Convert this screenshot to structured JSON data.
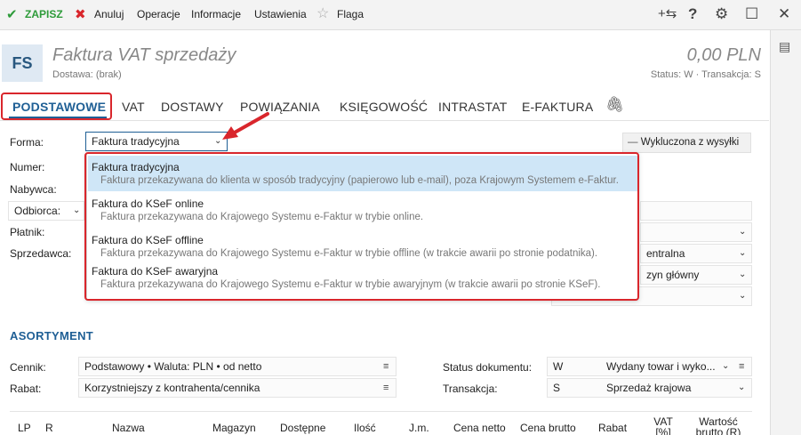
{
  "toolbar": {
    "save": "ZAPISZ",
    "cancel": "Anuluj",
    "operations": "Operacje",
    "information": "Informacje",
    "settings": "Ustawienia",
    "flag": "Flaga"
  },
  "header": {
    "badge": "FS",
    "title": "Faktura VAT sprzedaży",
    "subtitle": "Dostawa: (brak)",
    "amount": "0,00 PLN",
    "status": "Status:  W  ·  Transakcja:  S"
  },
  "tabs": [
    "PODSTAWOWE",
    "VAT",
    "DOSTAWY",
    "POWIĄZANIA",
    "KSIĘGOWOŚĆ",
    "INTRASTAT",
    "E-FAKTURA"
  ],
  "form": {
    "forma_label": "Forma:",
    "forma_value": "Faktura tradycyjna",
    "numer_label": "Numer:",
    "nabywca_label": "Nabywca:",
    "odbiorca_label": "Odbiorca:",
    "platnik_label": "Płatnik:",
    "sprzedawca_label": "Sprzedawca:",
    "excluded": "Wykluczona z wysyłki",
    "centralna": "entralna",
    "glowny": "zyn główny"
  },
  "dropdown": {
    "options": [
      {
        "title": "Faktura tradycyjna",
        "desc": "Faktura przekazywana do klienta w sposób tradycyjny (papierowo lub e-mail), poza Krajowym Systemem e-Faktur."
      },
      {
        "title": "Faktura do KSeF online",
        "desc": "Faktura przekazywana do Krajowego Systemu e-Faktur w trybie online."
      },
      {
        "title": "Faktura do KSeF offline",
        "desc": "Faktura przekazywana do Krajowego Systemu e-Faktur w trybie offline (w trakcie awarii po stronie podatnika)."
      },
      {
        "title": "Faktura do KSeF awaryjna",
        "desc": "Faktura przekazywana do Krajowego Systemu e-Faktur w trybie awaryjnym (w trakcie awarii po stronie KSeF)."
      }
    ]
  },
  "assortment": {
    "title": "ASORTYMENT",
    "cennik_label": "Cennik:",
    "cennik_value": "Podstawowy • Waluta: PLN • od netto",
    "rabat_label": "Rabat:",
    "rabat_value": "Korzystniejszy z kontrahenta/cennika",
    "status_label": "Status dokumentu:",
    "status_code": "W",
    "status_value": "Wydany towar i wyko...",
    "transakcja_label": "Transakcja:",
    "transakcja_code": "S",
    "transakcja_value": "Sprzedaż krajowa"
  },
  "table_headers": [
    "LP",
    "R",
    "Nazwa",
    "Magazyn",
    "Dostępne",
    "Ilość",
    "J.m.",
    "Cena netto",
    "Cena brutto",
    "Rabat",
    "VAT [%]",
    "Wartość brutto (R)"
  ],
  "colors": {
    "accent": "#1f5f95",
    "highlight": "#d9262c",
    "selected": "#cfe6f7"
  }
}
